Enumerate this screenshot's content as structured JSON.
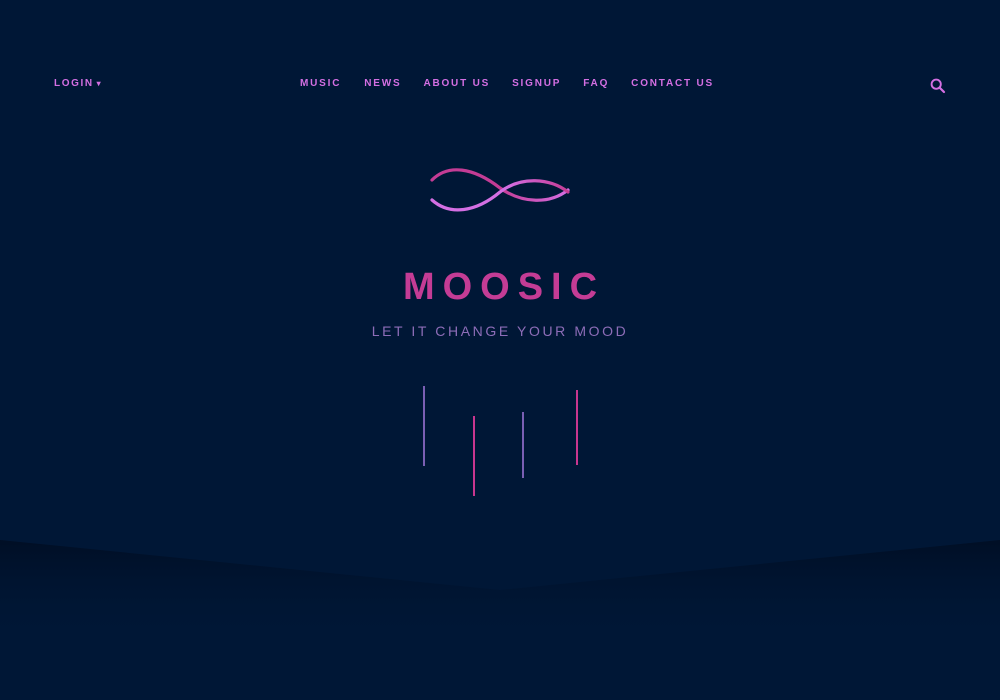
{
  "header": {
    "login_label": "LOGIN",
    "login_caret": "▾",
    "nav": [
      {
        "label": "MUSIC"
      },
      {
        "label": "NEWS"
      },
      {
        "label": "ABOUT US"
      },
      {
        "label": "SIGNUP"
      },
      {
        "label": "FAQ"
      },
      {
        "label": "CONTACT US"
      }
    ],
    "search_icon": "search-icon"
  },
  "hero": {
    "logo_icon": "infinity-wave-logo",
    "title": "MOOSIC",
    "tagline": "LET IT CHANGE YOUR MOOD"
  },
  "colors": {
    "background": "#001736",
    "accent_pink": "#d46fe3",
    "title_magenta": "#c43c95",
    "tagline_purple": "#8d6db8",
    "bar_purple": "#7a5fb3",
    "bar_pink": "#c8368f"
  }
}
